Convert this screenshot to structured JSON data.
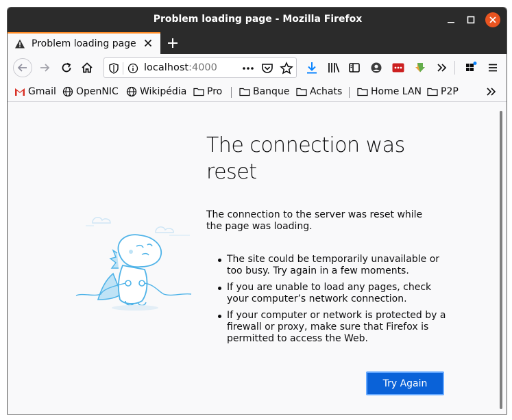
{
  "window": {
    "title": "Problem loading page - Mozilla Firefox"
  },
  "tabs": [
    {
      "label": "Problem loading page",
      "icon": "warning-icon"
    }
  ],
  "navbar": {
    "url_host": "localhost",
    "url_port": ":4000"
  },
  "bookmarks": [
    {
      "label": "Gmail",
      "icon": "gmail-icon"
    },
    {
      "label": "OpenNIC",
      "icon": "globe-icon"
    },
    {
      "label": "Wikipédia",
      "icon": "globe-icon"
    },
    {
      "label": "Pro",
      "icon": "folder-icon"
    },
    {
      "label": "Banque",
      "icon": "folder-icon"
    },
    {
      "label": "Achats",
      "icon": "folder-icon"
    },
    {
      "label": "Home LAN",
      "icon": "folder-icon"
    },
    {
      "label": "P2P",
      "icon": "folder-icon"
    }
  ],
  "error": {
    "title": "The connection was reset",
    "description": "The connection to the server was reset while the page was loading.",
    "bullets": [
      "The site could be temporarily unavailable or too busy. Try again in a few moments.",
      "If you are unable to load any pages, check your computer’s network connection.",
      "If your computer or network is protected by a firewall or proxy, make sure that Firefox is permitted to access the Web."
    ],
    "button_label": "Try Again"
  },
  "colors": {
    "accent": "#0a62d8",
    "titlebar": "#2b2b2b",
    "tab_highlight": "#ff8a24",
    "close_button": "#e95420"
  }
}
